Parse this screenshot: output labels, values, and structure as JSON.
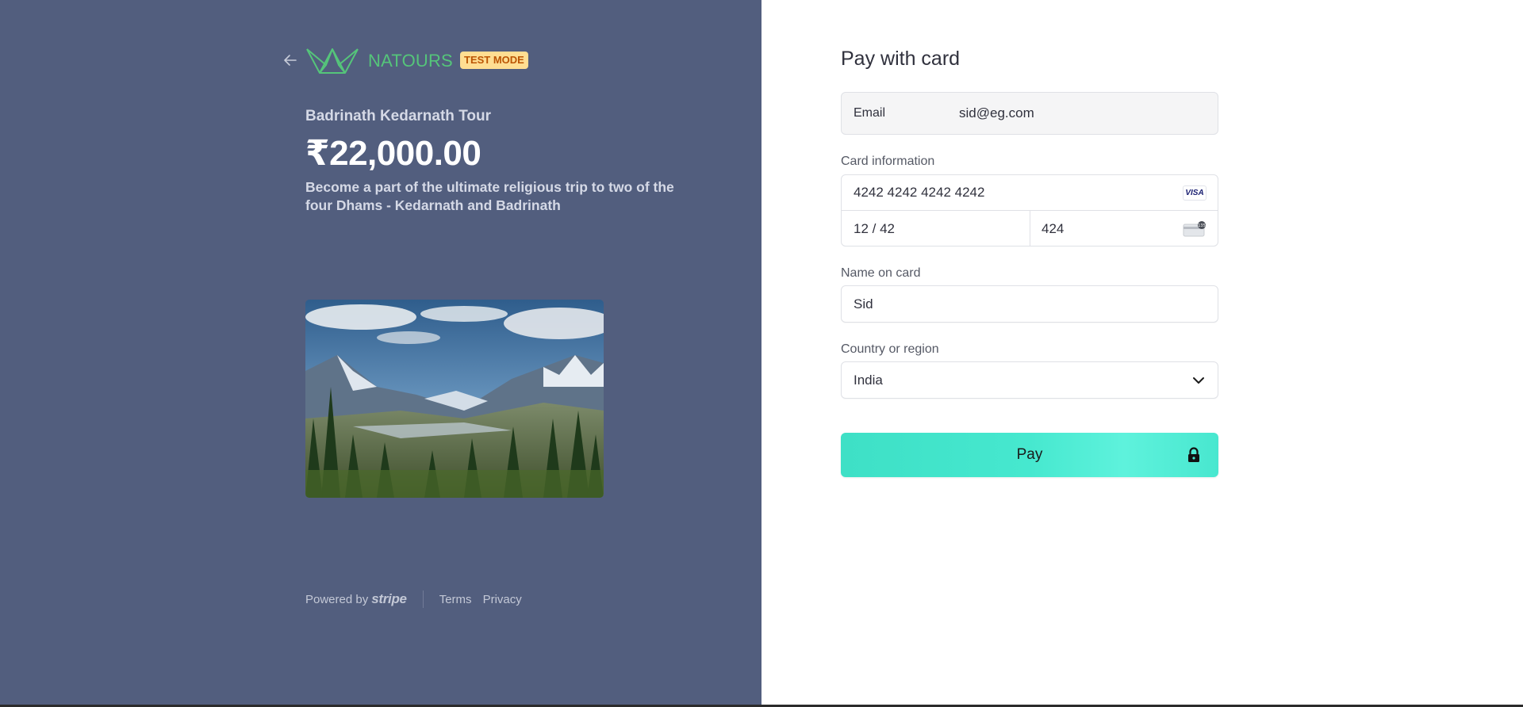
{
  "brand": {
    "name": "NATOURS",
    "badge": "TEST MODE",
    "accent_color": "#55c57a"
  },
  "product": {
    "name": "Badrinath Kedarnath Tour",
    "price": "₹22,000.00",
    "description": "Become a part of the ultimate religious trip to two of the four Dhams - Kedarnath and Badrinath"
  },
  "footer": {
    "powered_by": "Powered by",
    "stripe": "stripe",
    "terms": "Terms",
    "privacy": "Privacy"
  },
  "form": {
    "title": "Pay with card",
    "email_label": "Email",
    "email_value": "sid@eg.com",
    "card_label": "Card information",
    "card_number": "4242 4242 4242 4242",
    "card_brand": "VISA",
    "expiry": "12 / 42",
    "cvc": "424",
    "name_label": "Name on card",
    "name_value": "Sid",
    "country_label": "Country or region",
    "country_value": "India",
    "pay_label": "Pay"
  },
  "icons": {
    "back": "arrow-left-icon",
    "logo": "crown-logo-icon",
    "card_brand": "visa-icon",
    "cvc": "cvc-card-icon",
    "select": "chevron-down-icon",
    "lock": "lock-icon"
  },
  "colors": {
    "left_background": "#525e7e",
    "pay_button": "#46e8cf",
    "badge_background": "#ffde92",
    "badge_text": "#bb5504"
  }
}
